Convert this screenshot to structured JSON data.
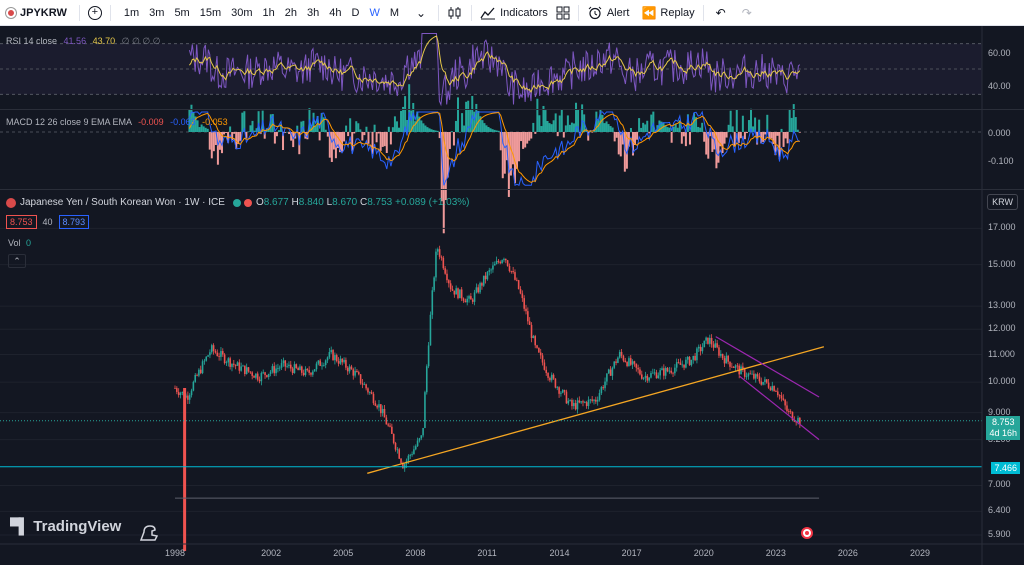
{
  "toolbar": {
    "symbol": "JPYKRW",
    "timeframes": [
      "1m",
      "3m",
      "5m",
      "15m",
      "30m",
      "1h",
      "2h",
      "3h",
      "4h",
      "D",
      "W",
      "M"
    ],
    "active_timeframe": "W",
    "indicators_label": "Indicators",
    "alert_label": "Alert",
    "replay_label": "Replay"
  },
  "rsi": {
    "label": "RSI 14 close",
    "value1": "41.56",
    "value2": "43.70",
    "extras": "∅ ∅ ∅ ∅",
    "axis": [
      "60.00",
      "40.00"
    ],
    "color_line": "#7e57c2",
    "color_ma": "#e6c84a"
  },
  "macd": {
    "label": "MACD 12 26 close 9 EMA EMA",
    "hist": "-0.009",
    "macd": "-0.063",
    "signal": "-0.053",
    "axis": [
      "0.000",
      "-0.100"
    ]
  },
  "main": {
    "title": "Japanese Yen / South Korean Won · 1W · ICE",
    "open": "8.677",
    "high": "8.840",
    "low": "8.670",
    "close": "8.753",
    "change": "+0.089 (+1.03%)",
    "bid": "8.753",
    "spread": "40",
    "ask": "8.793",
    "vol_label": "Vol",
    "vol_value": "0",
    "currency": "KRW",
    "last_price": "8.753",
    "countdown": "4d 16h",
    "hline_price": "7.466",
    "axis": [
      "17.000",
      "15.000",
      "13.000",
      "12.000",
      "11.000",
      "10.000",
      "9.000",
      "8.200",
      "7.000",
      "6.400",
      "5.900"
    ],
    "years": [
      "1998",
      "2002",
      "2005",
      "2008",
      "2011",
      "2014",
      "2017",
      "2020",
      "2023",
      "2026",
      "2029"
    ],
    "logo_text": "TradingView"
  },
  "colors": {
    "up": "#26a69a",
    "down": "#ef5350",
    "trendline": "#f5a623",
    "channel": "#9c27b0",
    "hline": "#00bcd4",
    "accent": "#2962ff"
  },
  "chart_data": {
    "type": "line",
    "title": "Japanese Yen / South Korean Won · 1W · ICE",
    "y_scale": "log",
    "ylim": [
      5.9,
      17.5
    ],
    "x": [
      1998.0,
      1998.5,
      1999.5,
      2000.5,
      2001.5,
      2002.5,
      2003.5,
      2004.5,
      2005.5,
      2006.5,
      2007.5,
      2008.3,
      2008.9,
      2009.5,
      2010.3,
      2011.0,
      2011.7,
      2012.3,
      2013.0,
      2013.6,
      2014.5,
      2015.5,
      2016.5,
      2017.5,
      2018.5,
      2019.5,
      2020.2,
      2020.8,
      2021.5,
      2022.5,
      2023.0,
      2023.5,
      2024.0
    ],
    "series": [
      {
        "values": [
          9.8,
          9.5,
          11.2,
          10.6,
          10.2,
          10.6,
          10.3,
          11.0,
          10.3,
          9.2,
          7.5,
          8.3,
          16.0,
          13.8,
          13.2,
          14.5,
          15.5,
          13.8,
          11.2,
          10.2,
          9.2,
          9.4,
          11.0,
          10.2,
          10.4,
          10.8,
          11.6,
          10.9,
          10.4,
          10.0,
          9.8,
          9.0,
          8.753
        ]
      }
    ],
    "trendline": {
      "x": [
        2006.0,
        2025.0
      ],
      "y": [
        7.3,
        11.3
      ]
    },
    "channel_upper": {
      "x": [
        2020.5,
        2024.8
      ],
      "y": [
        11.7,
        9.5
      ]
    },
    "channel_lower": {
      "x": [
        2021.5,
        2024.8
      ],
      "y": [
        10.2,
        8.2
      ]
    },
    "hline": 7.466
  }
}
